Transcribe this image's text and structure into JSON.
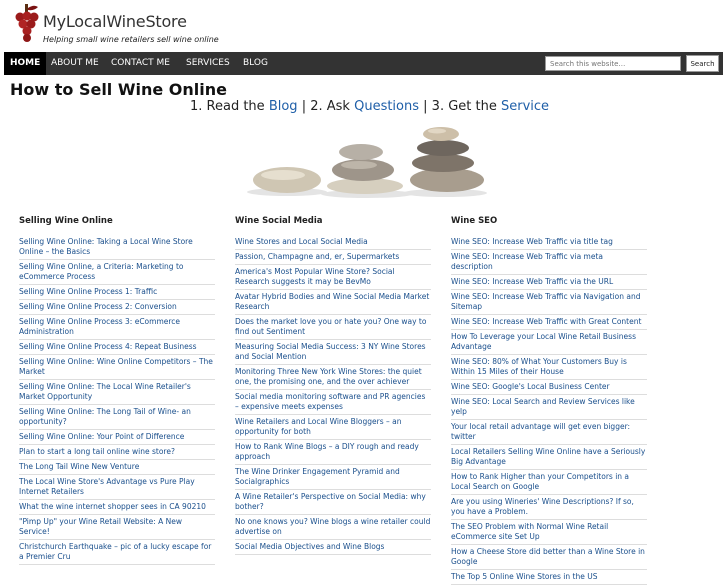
{
  "site": {
    "title": "MyLocalWineStore",
    "tagline": "Helping small wine retailers sell wine online"
  },
  "nav": {
    "items": [
      "HOME",
      "ABOUT ME",
      "CONTACT ME",
      "SERVICES",
      "BLOG"
    ],
    "active": "HOME"
  },
  "search": {
    "placeholder": "Search this website…",
    "button_label": "Search"
  },
  "main": {
    "title": "How to Sell Wine Online",
    "steps": {
      "prefix1": "1. Read the",
      "link1": "Blog",
      "sep1": "| 2. Ask",
      "link2": "Questions",
      "sep2": "| 3. Get the",
      "link3": "Service"
    }
  },
  "columns": [
    {
      "heading": "Selling Wine Online",
      "links": [
        "Selling Wine Online: Taking a Local Wine Store Online – the Basics",
        "Selling Wine Online, a Criteria: Marketing to eCommerce Process",
        "Selling Wine Online Process 1: Traffic",
        "Selling Wine Online Process 2: Conversion",
        "Selling Wine Online Process 3: eCommerce Administration",
        "Selling Wine Online Process 4: Repeat Business",
        "Selling Wine Online: Wine Online Competitors – The Market",
        "Selling Wine Online: The Local Wine Retailer's Market Opportunity",
        "Selling Wine Online: The Long Tail of Wine- an opportunity?",
        "Selling Wine Online: Your Point of Difference",
        "Plan to start a long tail online wine store?",
        "The Long Tail Wine New Venture",
        "The Local Wine Store's Advantage vs Pure Play Internet Retailers",
        "What the wine internet shopper sees in CA 90210",
        "\"Pimp Up\" your Wine Retail Website: A New Service!",
        "Christchurch Earthquake – pic of a lucky escape for a Premier Cru"
      ]
    },
    {
      "heading": "Wine Social Media",
      "links": [
        "Wine Stores and Local Social Media",
        "Passion, Champagne and, er, Supermarkets",
        "America's Most Popular Wine Store? Social Research suggests it may be BevMo",
        "Avatar Hybrid Bodies and Wine Social Media Market Research",
        "Does the market love you or hate you? One way to find out Sentiment",
        "Measuring Social Media Success: 3 NY Wine Stores and Social Mention",
        "Monitoring Three New York Wine Stores: the quiet one, the promising one, and the over achiever",
        "Social media monitoring software and PR agencies – expensive meets expenses",
        "Wine Retailers and Local Wine Bloggers – an opportunity for both",
        "How to Rank Wine Blogs – a DIY rough and ready approach",
        "The Wine Drinker Engagement Pyramid and Socialgraphics",
        "A Wine Retailer's Perspective on Social Media: why bother?",
        "No one knows you? Wine blogs a wine retailer could advertise on",
        "Social Media Objectives and Wine Blogs"
      ]
    },
    {
      "heading": "Wine SEO",
      "links": [
        "Wine SEO: Increase Web Traffic via title tag",
        "Wine SEO: Increase Web Traffic via meta description",
        "Wine SEO: Increase Web Traffic via the URL",
        "Wine SEO: Increase Web Traffic via Navigation and Sitemap",
        "Wine SEO: Increase Web Traffic with Great Content",
        "How To Leverage your Local Wine Retail Business Advantage",
        "Wine SEO: 80% of What Your Customers Buy is Within 15 Miles of their House",
        "Wine SEO: Google's Local Business Center",
        "Wine SEO: Local Search and Review Services like yelp",
        "Your local retail advantage will get even bigger: twitter",
        "Local Retailers Selling Wine Online have a Seriously Big Advantage",
        "How to Rank Higher than your Competitors in a Local Search on Google",
        "Are you using Wineries' Wine Descriptions? If so, you have a Problem.",
        "The SEO Problem with Normal Wine Retail eCommerce site Set Up",
        "How a Cheese Store did better than a Wine Store in Google",
        "The Top 5 Online Wine Stores in the US"
      ]
    }
  ],
  "colors": {
    "nav_bg": "#333333",
    "nav_active": "#000000",
    "link": "#1a4f8c",
    "logo": "#9b1b1b"
  }
}
